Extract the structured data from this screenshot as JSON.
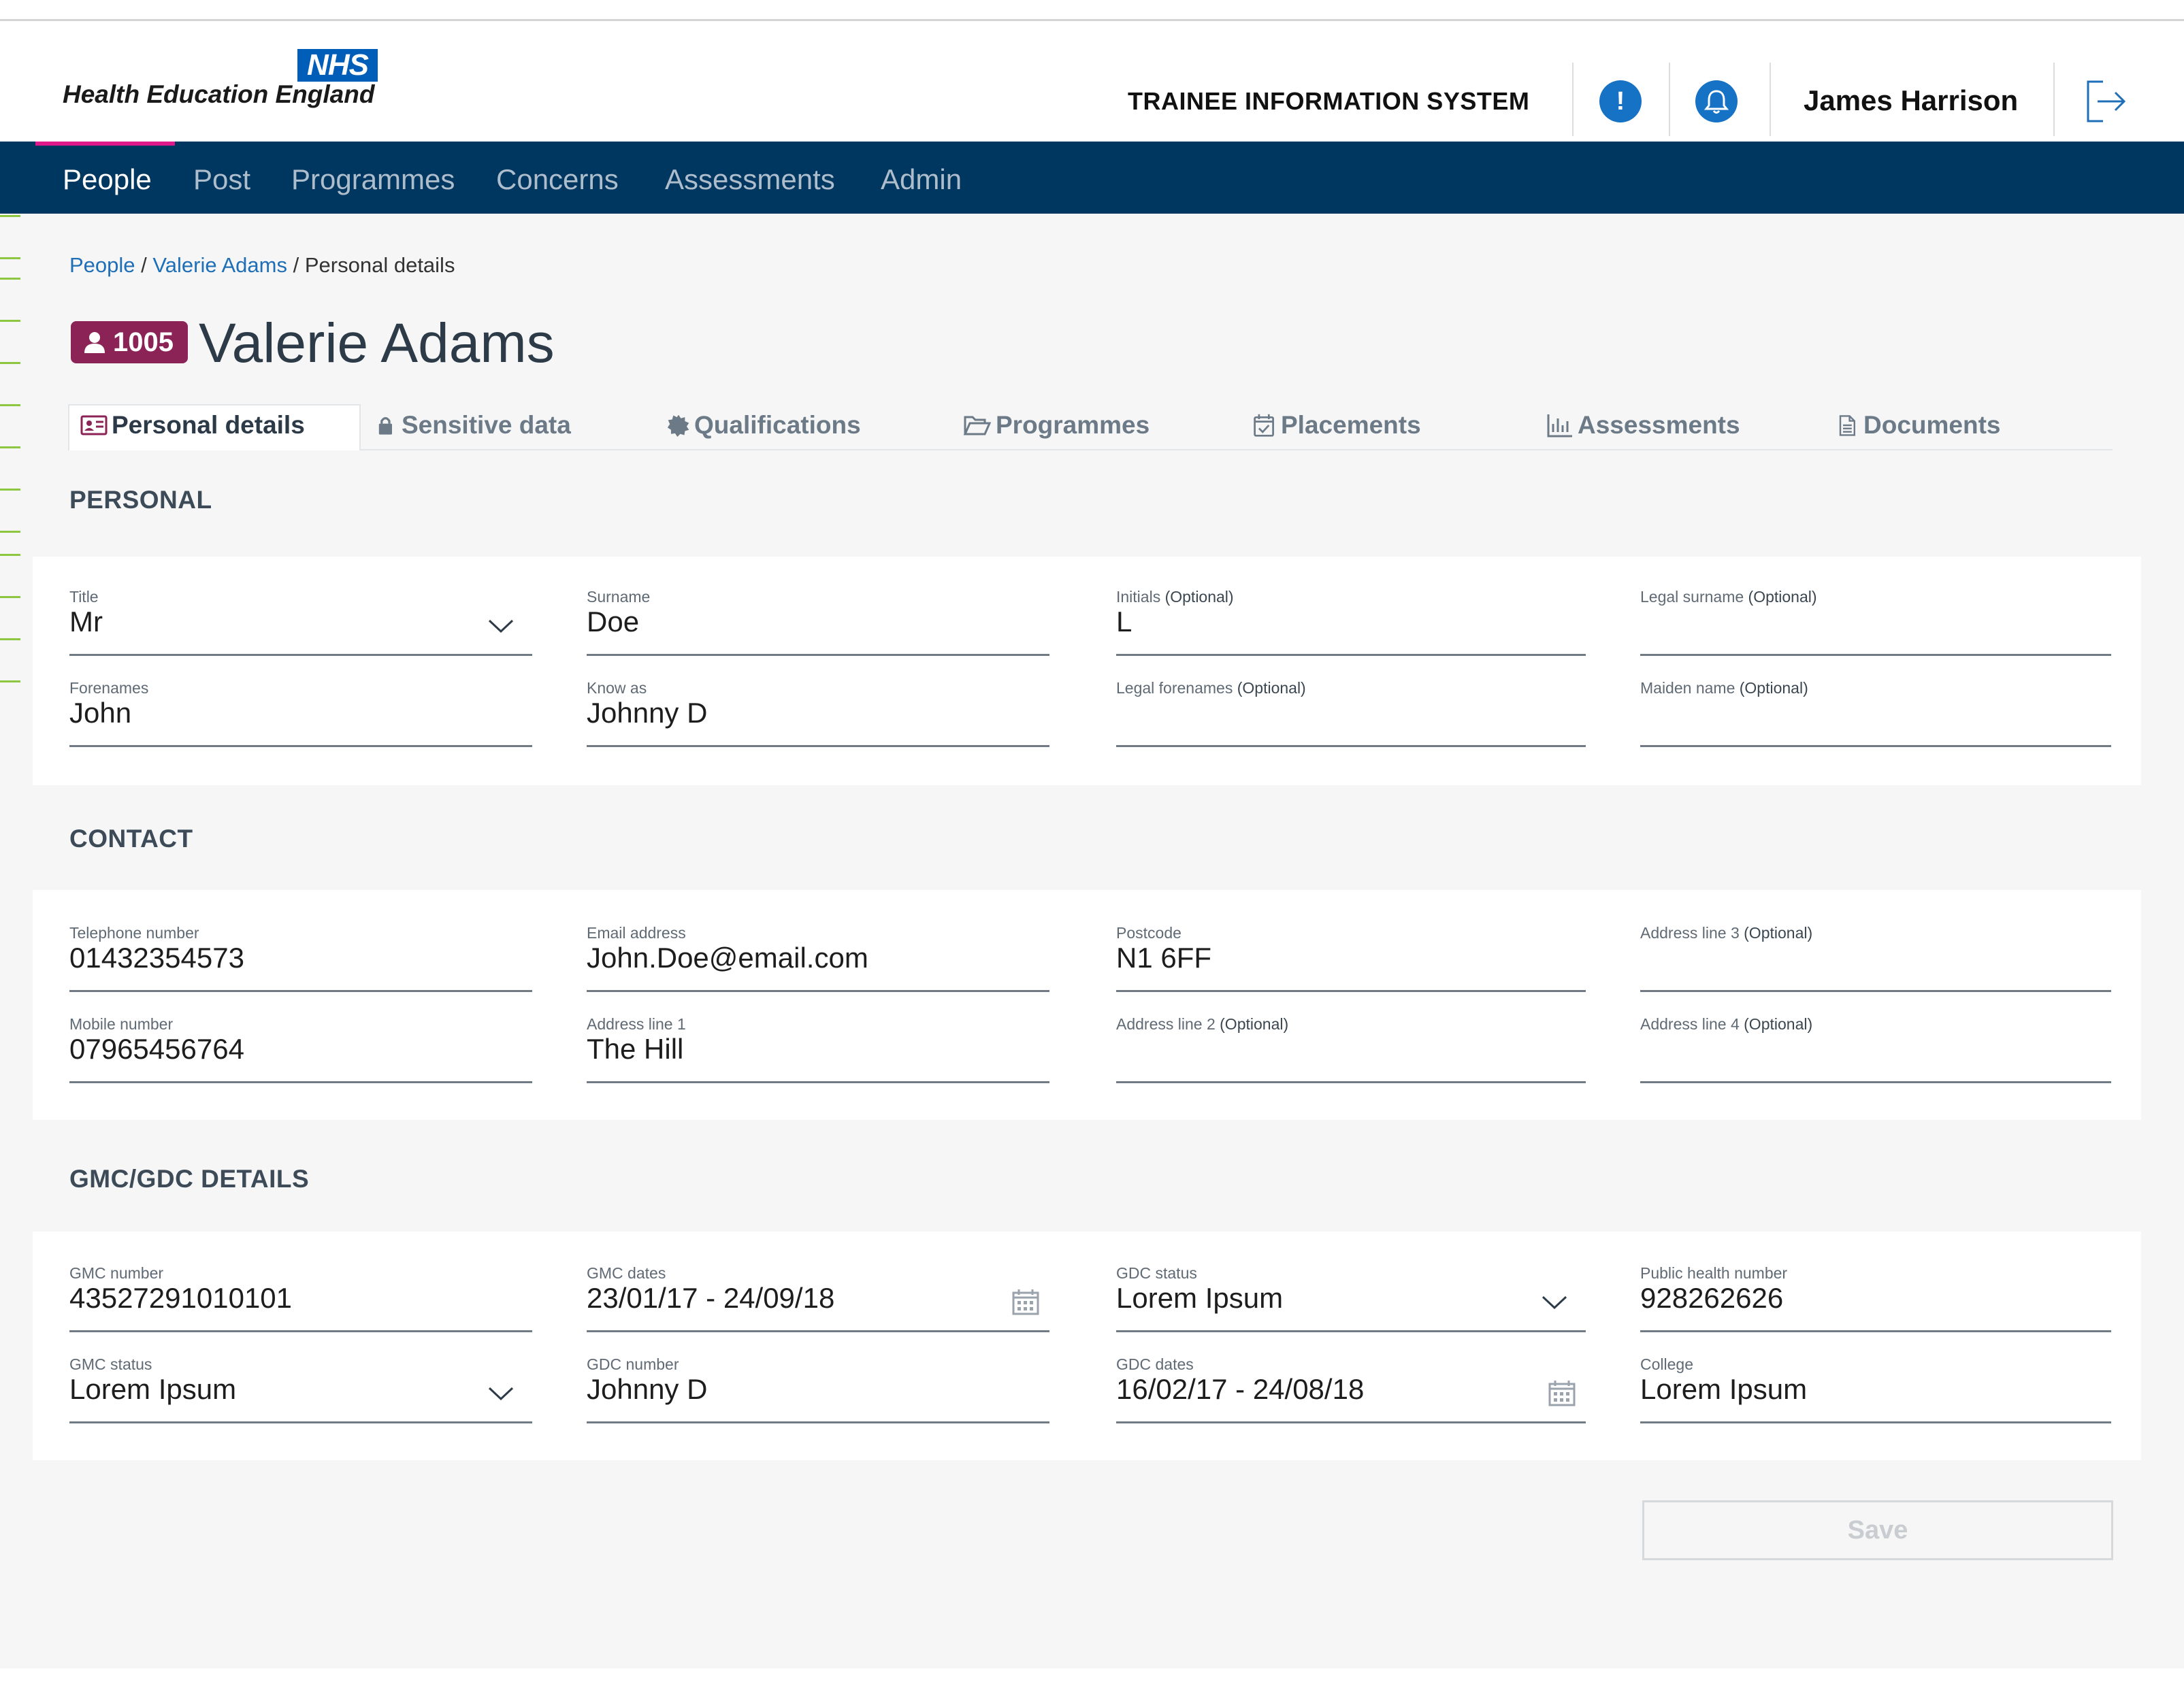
{
  "header": {
    "logo_badge": "NHS",
    "logo_text": "Health Education England",
    "system_title": "TRAINEE INFORMATION SYSTEM",
    "user_name": "James Harrison",
    "accent_color": "#1572c4"
  },
  "nav": {
    "items": [
      {
        "label": "People",
        "active": true
      },
      {
        "label": "Post"
      },
      {
        "label": "Programmes"
      },
      {
        "label": "Concerns"
      },
      {
        "label": "Assessments"
      },
      {
        "label": "Admin"
      }
    ],
    "background": "#003761",
    "active_indicator_color": "#e0198a"
  },
  "breadcrumb": {
    "items": [
      "People",
      "Valerie Adams",
      "Personal details"
    ],
    "separator": "/"
  },
  "person": {
    "id": "1005",
    "name": "Valerie Adams",
    "badge_color": "#8b2356"
  },
  "tabs": [
    {
      "label": "Personal details",
      "icon": "id-card-icon",
      "active": true
    },
    {
      "label": "Sensitive data",
      "icon": "lock-icon"
    },
    {
      "label": "Qualifications",
      "icon": "badge-icon"
    },
    {
      "label": "Programmes",
      "icon": "folder-open-icon"
    },
    {
      "label": "Placements",
      "icon": "calendar-check-icon"
    },
    {
      "label": "Assessments",
      "icon": "bar-chart-icon"
    },
    {
      "label": "Documents",
      "icon": "document-icon"
    }
  ],
  "optional_tag": "(Optional)",
  "personal": {
    "title": "PERSONAL",
    "fields": {
      "title": {
        "label": "Title",
        "value": "Mr"
      },
      "surname": {
        "label": "Surname",
        "value": "Doe"
      },
      "initials": {
        "label": "Initials",
        "value": "L"
      },
      "legal_surname": {
        "label": "Legal surname",
        "value": ""
      },
      "forenames": {
        "label": "Forenames",
        "value": "John"
      },
      "known_as": {
        "label": "Know as",
        "value": "Johnny D"
      },
      "legal_forenames": {
        "label": "Legal forenames",
        "value": ""
      },
      "maiden_name": {
        "label": "Maiden name",
        "value": ""
      }
    }
  },
  "contact": {
    "title": "CONTACT",
    "fields": {
      "telephone": {
        "label": "Telephone number",
        "value": "01432354573"
      },
      "email": {
        "label": "Email address",
        "value": "John.Doe@email.com"
      },
      "postcode": {
        "label": "Postcode",
        "value": "N1 6FF"
      },
      "address3": {
        "label": "Address line 3",
        "value": ""
      },
      "mobile": {
        "label": "Mobile number",
        "value": "07965456764"
      },
      "address1": {
        "label": "Address line 1",
        "value": "The Hill"
      },
      "address2": {
        "label": "Address line 2",
        "value": ""
      },
      "address4": {
        "label": "Address line 4",
        "value": ""
      }
    }
  },
  "gmc": {
    "title": "GMC/GDC DETAILS",
    "fields": {
      "gmc_number": {
        "label": "GMC number",
        "value": "43527291010101"
      },
      "gmc_dates": {
        "label": "GMC dates",
        "value": "23/01/17 - 24/09/18"
      },
      "gdc_status": {
        "label": "GDC status",
        "value": "Lorem Ipsum"
      },
      "public_health_number": {
        "label": "Public health number",
        "value": "928262626"
      },
      "gmc_status": {
        "label": "GMC status",
        "value": "Lorem Ipsum"
      },
      "gdc_number": {
        "label": "GDC number",
        "value": "Johnny D"
      },
      "gdc_dates": {
        "label": "GDC dates",
        "value": "16/02/17 - 24/08/18"
      },
      "college": {
        "label": "College",
        "value": "Lorem Ipsum"
      }
    }
  },
  "actions": {
    "save_label": "Save"
  }
}
